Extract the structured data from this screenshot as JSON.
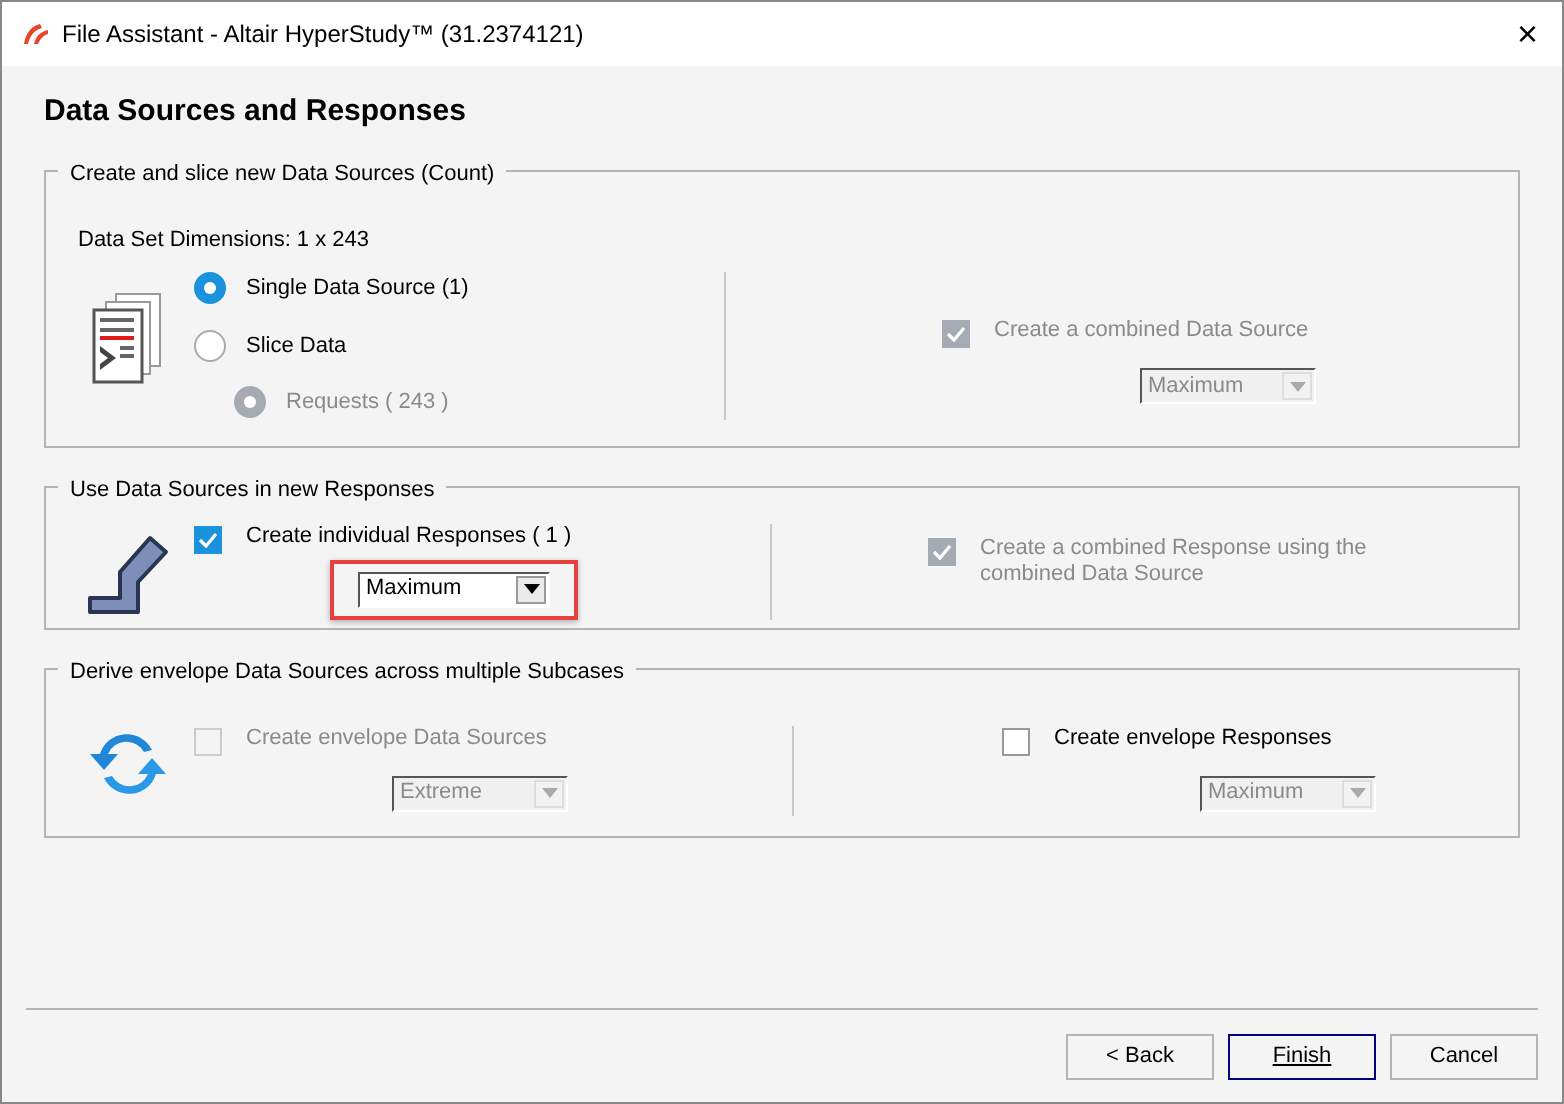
{
  "window": {
    "title": "File Assistant - Altair HyperStudy™ (31.2374121)",
    "close": "×"
  },
  "heading": "Data Sources and Responses",
  "groups": [
    {
      "title": "Create and slice new Data Sources (Count)",
      "dimensions": "Data Set Dimensions: 1 x 243",
      "left": [
        {
          "kind": "radio",
          "label": "Single Data Source (1)",
          "selected": true,
          "disabled": false
        },
        {
          "kind": "radio",
          "label": "Slice Data",
          "selected": false,
          "disabled": false,
          "children": [
            {
              "kind": "radio",
              "label": "Requests ( 243 )",
              "selected": true,
              "disabled": true
            }
          ]
        }
      ],
      "right": [
        {
          "kind": "checkbox",
          "label": "Create a combined Data Source",
          "checked": true,
          "disabled": true,
          "dropdown": {
            "value": "Maximum",
            "disabled": true,
            "highlighted": false
          }
        }
      ]
    },
    {
      "title": "Use Data Sources in new Responses",
      "left": [
        {
          "kind": "checkbox",
          "label": "Create individual Responses ( 1 )",
          "checked": true,
          "disabled": false,
          "dropdown": {
            "value": "Maximum",
            "disabled": false,
            "highlighted": true
          }
        }
      ],
      "right": [
        {
          "kind": "checkbox",
          "label": "Create a combined Response using the combined Data Source",
          "checked": true,
          "disabled": true
        }
      ]
    },
    {
      "title": "Derive envelope Data Sources across multiple Subcases",
      "left": [
        {
          "kind": "checkbox",
          "label": "Create envelope Data Sources",
          "checked": false,
          "disabled": true,
          "dropdown": {
            "value": "Extreme",
            "disabled": true,
            "highlighted": false
          }
        }
      ],
      "right": [
        {
          "kind": "checkbox",
          "label": "Create envelope Responses",
          "checked": false,
          "disabled": false,
          "dropdown": {
            "value": "Maximum",
            "disabled": true,
            "highlighted": false
          }
        }
      ]
    }
  ],
  "buttons": [
    {
      "label": "< Back",
      "default": false
    },
    {
      "label": "Finish",
      "default": true
    },
    {
      "label": "Cancel",
      "default": false
    }
  ]
}
